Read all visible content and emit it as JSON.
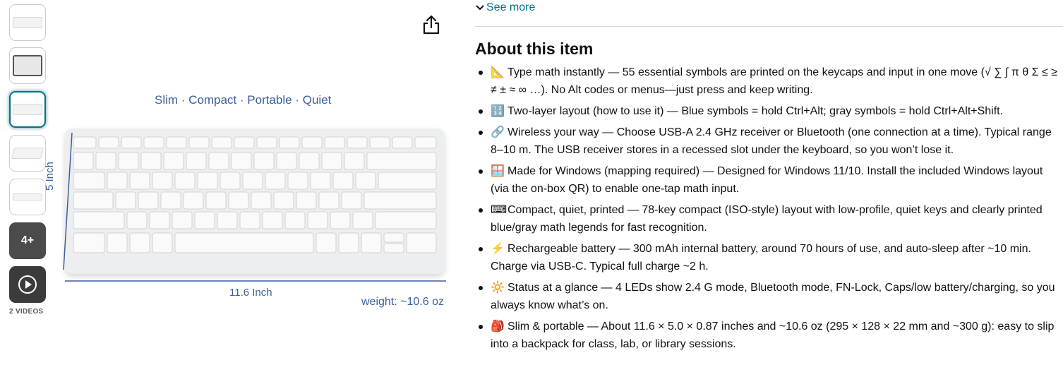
{
  "thumbnails": {
    "more_label": "4+",
    "videos_label": "2 VIDEOS"
  },
  "product_image": {
    "tagline": "Slim · Compact · Portable · Quiet",
    "height_dim": "5 Inch",
    "width_dim": "11.6 Inch",
    "weight": "weight: ~10.6 oz"
  },
  "see_more_label": "See more",
  "about": {
    "title": "About this item",
    "bullets": [
      {
        "icon": "📐",
        "icon_name": "triangle-ruler-icon",
        "text": "Type math instantly — 55 essential symbols are printed on the keycaps and input in one move (√ ∑ ∫ π θ Σ ≤ ≥ ≠ ± ≈ ∞ …). No Alt codes or menus—just press and keep writing."
      },
      {
        "icon": "🔢",
        "icon_name": "keypad-icon",
        "text": "Two-layer layout (how to use it) — Blue symbols = hold Ctrl+Alt; gray symbols = hold Ctrl+Alt+Shift."
      },
      {
        "icon": "🔗",
        "icon_name": "link-icon",
        "text": "Wireless your way — Choose USB-A 2.4 GHz receiver or Bluetooth (one connection at a time). Typical range 8–10 m. The USB receiver stores in a recessed slot under the keyboard, so you won’t lose it."
      },
      {
        "icon": "🪟",
        "icon_name": "window-icon",
        "text": "Made for Windows (mapping required) — Designed for Windows 11/10. Install the included Windows layout (via the on-box QR) to enable one-tap math input."
      },
      {
        "icon": "⌨",
        "icon_name": "keyboard-icon",
        "text": "Compact, quiet, printed — 78-key compact (ISO-style) layout with low-profile, quiet keys and clearly printed blue/gray math legends for fast recognition."
      },
      {
        "icon": "⚡",
        "icon_name": "lightning-icon",
        "text": "Rechargeable battery — 300 mAh internal battery, around 70 hours of use, and auto-sleep after ~10 min. Charge via USB-C. Typical full charge ~2 h."
      },
      {
        "icon": "🔆",
        "icon_name": "sun-icon",
        "text": "Status at a glance — 4 LEDs show 2.4 G mode, Bluetooth mode, FN-Lock, Caps/low battery/charging, so you always know what’s on."
      },
      {
        "icon": "🎒",
        "icon_name": "backpack-icon",
        "text": "Slim & portable — About 11.6 × 5.0 × 0.87 inches and ~10.6 oz (295 × 128 × 22 mm and ~300 g): easy to slip into a backpack for class, lab, or library sessions."
      }
    ]
  }
}
